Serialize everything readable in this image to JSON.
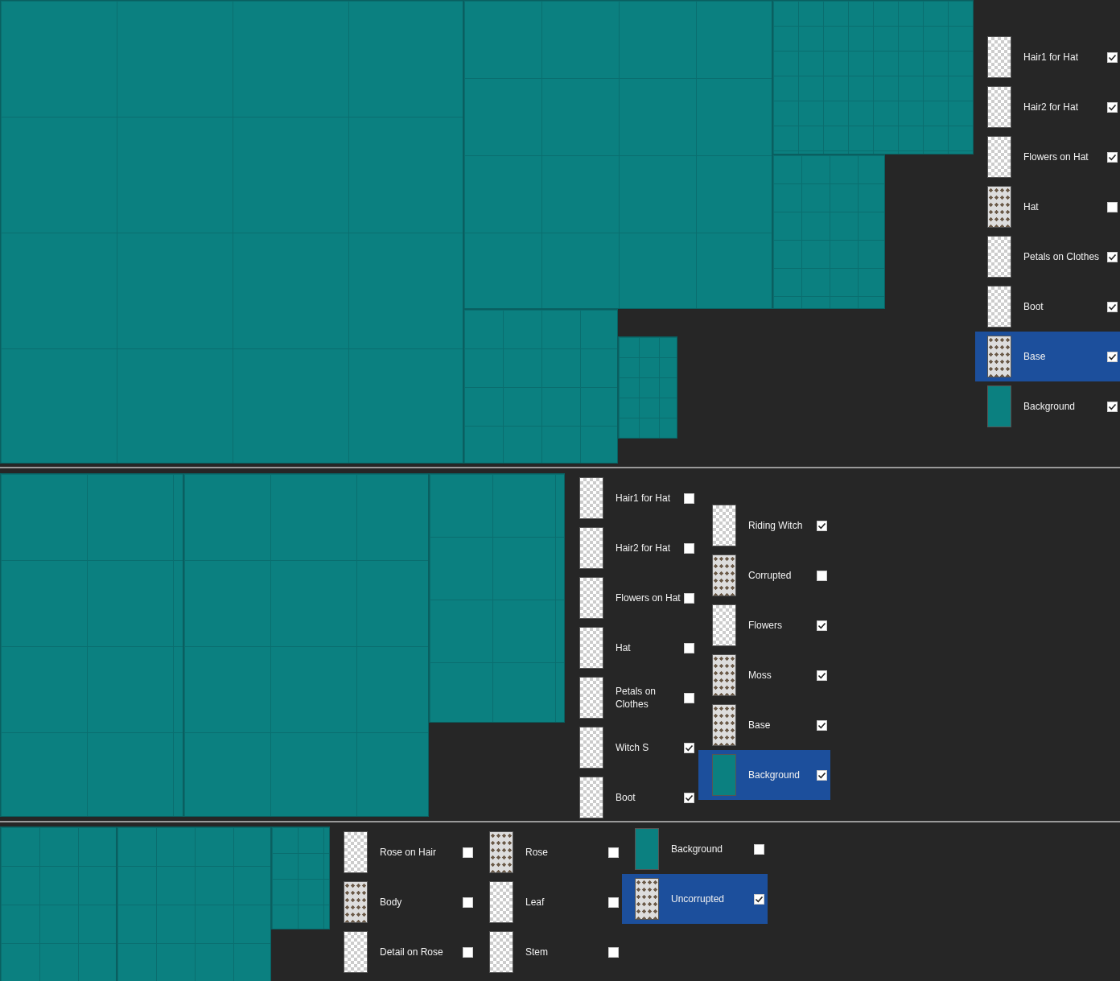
{
  "sections": [
    {
      "layer_columns": [
        [
          {
            "label": "Hair1 for Hat",
            "kind": "checker",
            "checked": true,
            "selected": false
          },
          {
            "label": "Hair2 for Hat",
            "kind": "checker",
            "checked": true,
            "selected": false
          },
          {
            "label": "Flowers on Hat",
            "kind": "checker",
            "checked": true,
            "selected": false
          },
          {
            "label": "Hat",
            "kind": "sprites",
            "checked": false,
            "selected": false
          },
          {
            "label": "Petals on Clothes",
            "kind": "checker",
            "checked": true,
            "selected": false
          },
          {
            "label": "Boot",
            "kind": "checker",
            "checked": true,
            "selected": false
          },
          {
            "label": "Base",
            "kind": "sprites",
            "checked": true,
            "selected": true
          },
          {
            "label": "Background",
            "kind": "fill",
            "checked": true,
            "selected": false
          }
        ]
      ]
    },
    {
      "layer_columns": [
        [
          {
            "label": "Hair1 for Hat",
            "kind": "checker",
            "checked": false,
            "selected": false
          },
          {
            "label": "Hair2 for Hat",
            "kind": "checker",
            "checked": false,
            "selected": false
          },
          {
            "label": "Flowers on Hat",
            "kind": "checker",
            "checked": false,
            "selected": false
          },
          {
            "label": "Hat",
            "kind": "checker",
            "checked": false,
            "selected": false
          },
          {
            "label": "Petals on Clothes",
            "kind": "checker",
            "checked": false,
            "selected": false
          },
          {
            "label": "Witch S",
            "kind": "checker",
            "checked": true,
            "selected": false
          },
          {
            "label": "Boot",
            "kind": "checker",
            "checked": true,
            "selected": false
          }
        ],
        [
          {
            "label": "Riding Witch",
            "kind": "checker",
            "checked": true,
            "selected": false
          },
          {
            "label": "Corrupted",
            "kind": "sprites",
            "checked": false,
            "selected": false
          },
          {
            "label": "Flowers",
            "kind": "checker",
            "checked": true,
            "selected": false
          },
          {
            "label": "Moss",
            "kind": "sprites",
            "checked": true,
            "selected": false
          },
          {
            "label": "Base",
            "kind": "sprites",
            "checked": true,
            "selected": false
          },
          {
            "label": "Background",
            "kind": "fill",
            "checked": true,
            "selected": true
          }
        ]
      ]
    },
    {
      "layer_columns": [
        [
          {
            "label": "Rose on Hair",
            "kind": "checker",
            "checked": false,
            "selected": false
          },
          {
            "label": "Body",
            "kind": "sprites",
            "checked": false,
            "selected": false
          },
          {
            "label": "Detail on Rose",
            "kind": "checker",
            "checked": false,
            "selected": false
          }
        ],
        [
          {
            "label": "Rose",
            "kind": "sprites",
            "checked": false,
            "selected": false
          },
          {
            "label": "Leaf",
            "kind": "checker",
            "checked": false,
            "selected": false
          },
          {
            "label": "Stem",
            "kind": "checker",
            "checked": false,
            "selected": false
          }
        ],
        [
          {
            "label": "Background",
            "kind": "fill",
            "checked": false,
            "selected": false
          },
          {
            "label": "Uncorrupted",
            "kind": "sprites",
            "checked": true,
            "selected": true
          }
        ]
      ]
    }
  ]
}
